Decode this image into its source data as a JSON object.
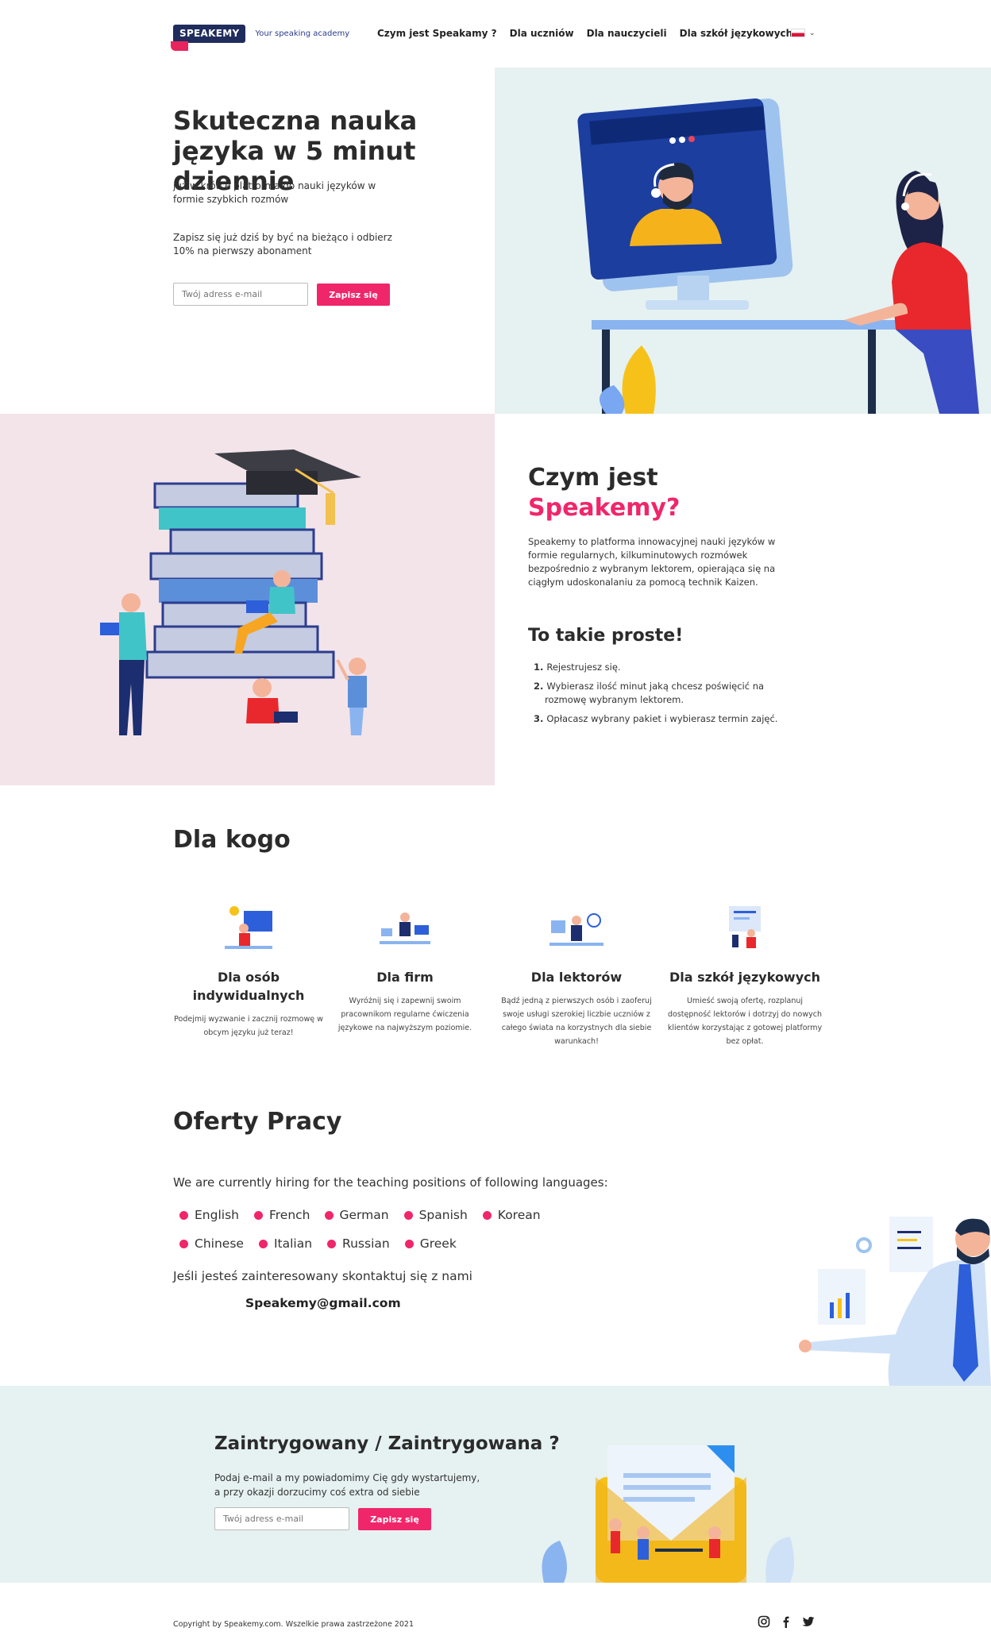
{
  "header": {
    "logo": "SPEAKEMY",
    "tagline": "Your speaking academy",
    "nav": [
      "Czym jest Speakamy ?",
      "Dla uczniów",
      "Dla nauczycieli",
      "Dla szkół językowych"
    ],
    "language_flag": "pl-flag-icon"
  },
  "hero": {
    "title": "Skuteczna nauka języka w 5 minut dziennie",
    "subtitle": "już w krótce platforma do nauki języków w formie szybkich rozmów",
    "promo": "Zapisz się już dziś by być na bieżąco i odbierz 10% na pierwszy abonament",
    "email_placeholder": "Twój adress e-mail",
    "button": "Zapisz się"
  },
  "about": {
    "title_line1": "Czym jest",
    "title_line2": "Speakemy?",
    "description": "Speakemy to platforma innowacyjnej nauki języków w formie regularnych, kilkuminutowych rozmówek bezpośrednio z wybranym lektorem, opierająca się na ciągłym udoskonalaniu za pomocą technik Kaizen.",
    "simple_title": "To takie proste!",
    "steps": [
      {
        "num": "1.",
        "text": "Rejestrujesz się."
      },
      {
        "num": "2.",
        "text": "Wybierasz ilość minut jaką chcesz poświęcić na rozmowę wybranym lektorem."
      },
      {
        "num": "3.",
        "text": "Opłacasz wybrany pakiet i wybierasz termin zajęć."
      }
    ]
  },
  "for_whom": {
    "title": "Dla kogo",
    "items": [
      {
        "title": "Dla osób indywidualnych",
        "text": "Podejmij wyzwanie i zacznij rozmowę w obcym języku już teraz!"
      },
      {
        "title": "Dla firm",
        "text": "Wyróżnij się i zapewnij swoim pracownikom regularne ćwiczenia językowe na najwyższym poziomie."
      },
      {
        "title": "Dla lektorów",
        "text": "Bądź jedną z pierwszych osób i zaoferuj swoje usługi szerokiej liczbie uczniów z całego świata na korzystnych dla siebie warunkach!"
      },
      {
        "title": "Dla szkół językowych",
        "text": "Umieść swoją ofertę, rozplanuj dostępność lektorów i dotrzyj do nowych klientów korzystając z gotowej platformy bez opłat."
      }
    ]
  },
  "jobs": {
    "title": "Oferty Pracy",
    "intro": "We are currently hiring for the teaching positions of following languages:",
    "languages_row1": [
      "English",
      "French",
      "German",
      "Spanish",
      "Korean"
    ],
    "languages_row2": [
      "Chinese",
      "Italian",
      "Russian",
      "Greek"
    ],
    "contact_text": "Jeśli jesteś zainteresowany skontaktuj się z nami",
    "contact_email": "Speakemy@gmail.com"
  },
  "newsletter": {
    "title": "Zaintrygowany / Zaintrygowana ?",
    "description": "Podaj e-mail a my powiadomimy Cię gdy wystartujemy, a przy okazji dorzucimy coś extra od siebie",
    "email_placeholder": "Twój adress e-mail",
    "button": "Zapisz się"
  },
  "footer": {
    "copyright": "Copyright by Speakemy.com. Wszelkie prawa zastrzeżone 2021",
    "social": [
      "instagram-icon",
      "facebook-icon",
      "twitter-icon"
    ]
  },
  "colors": {
    "accent": "#f0266a",
    "navy": "#1f2c5c",
    "mint_bg": "#e6f1f1",
    "pink_bg": "#f3e4ea"
  }
}
